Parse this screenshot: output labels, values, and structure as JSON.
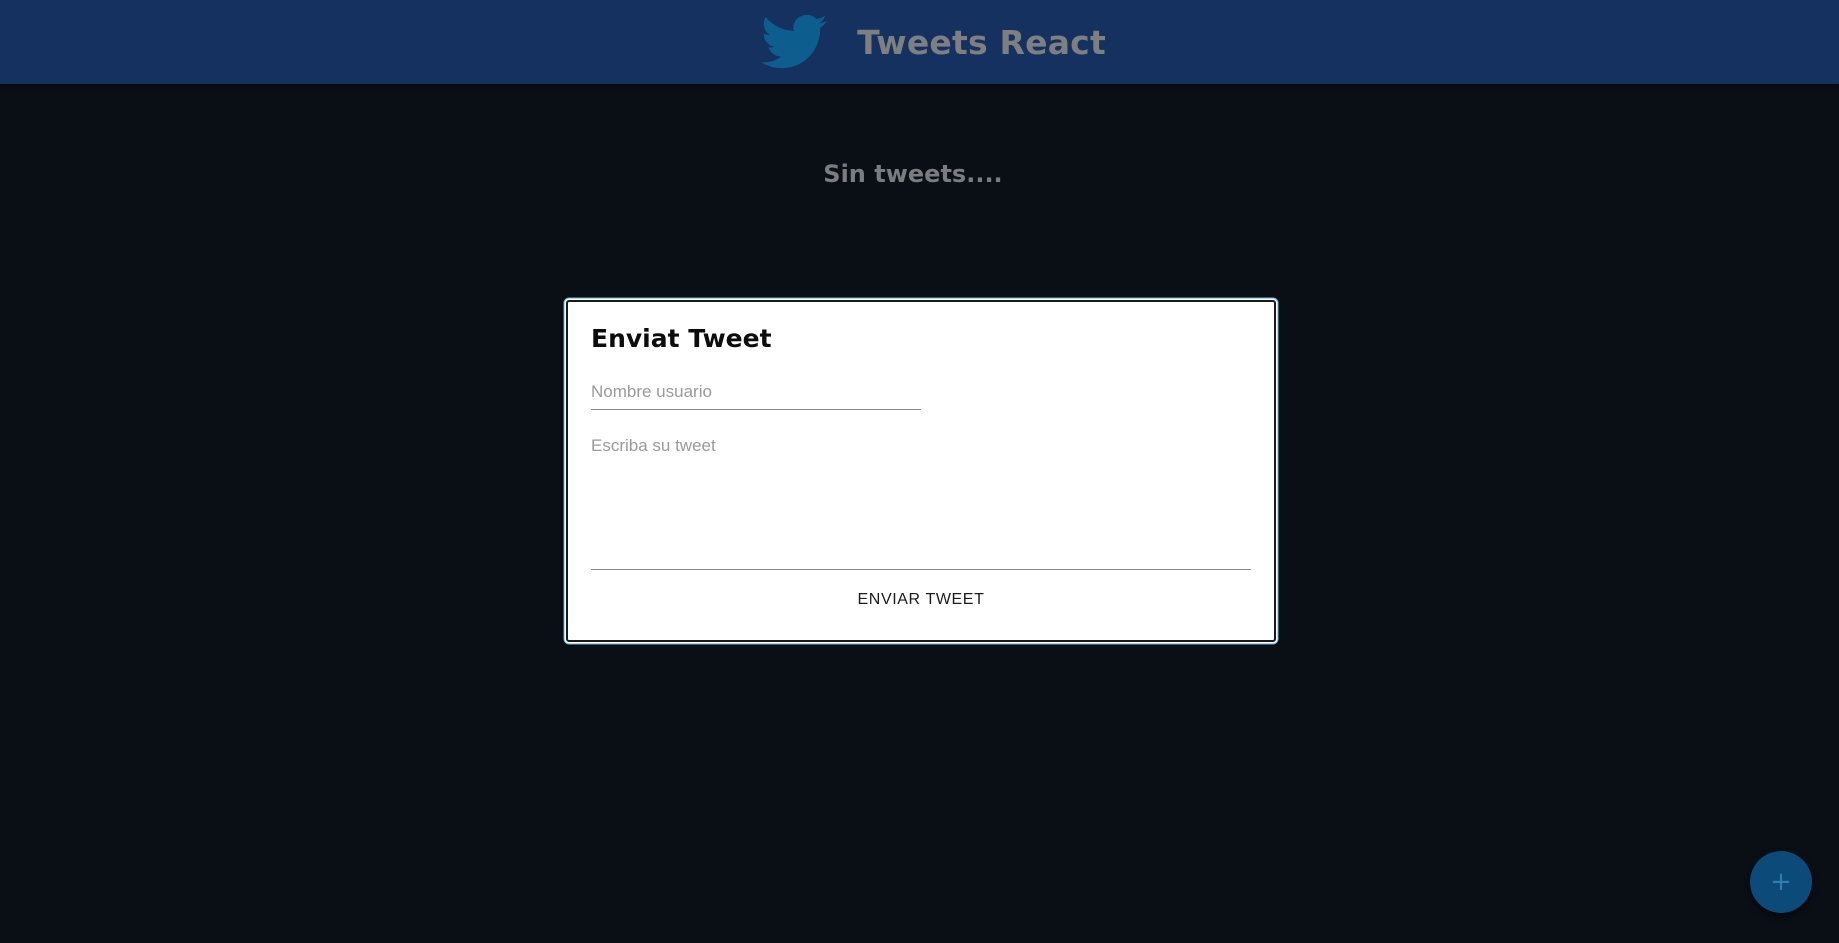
{
  "header": {
    "logo_icon": "twitter-bird-icon",
    "title": "Tweets React"
  },
  "main": {
    "empty_message": "Sin tweets...."
  },
  "modal": {
    "title": "Enviat Tweet",
    "username": {
      "value": "",
      "placeholder": "Nombre usuario"
    },
    "tweet": {
      "value": "",
      "placeholder": "Escriba su tweet"
    },
    "send_label": "ENVIAR TWEET"
  },
  "fab": {
    "icon": "plus-icon",
    "label": "+"
  },
  "colors": {
    "header_bg": "#14315f",
    "page_bg": "#0a0e15",
    "logo": "#0d5e8e",
    "fab_bg": "#0c4a7a"
  }
}
